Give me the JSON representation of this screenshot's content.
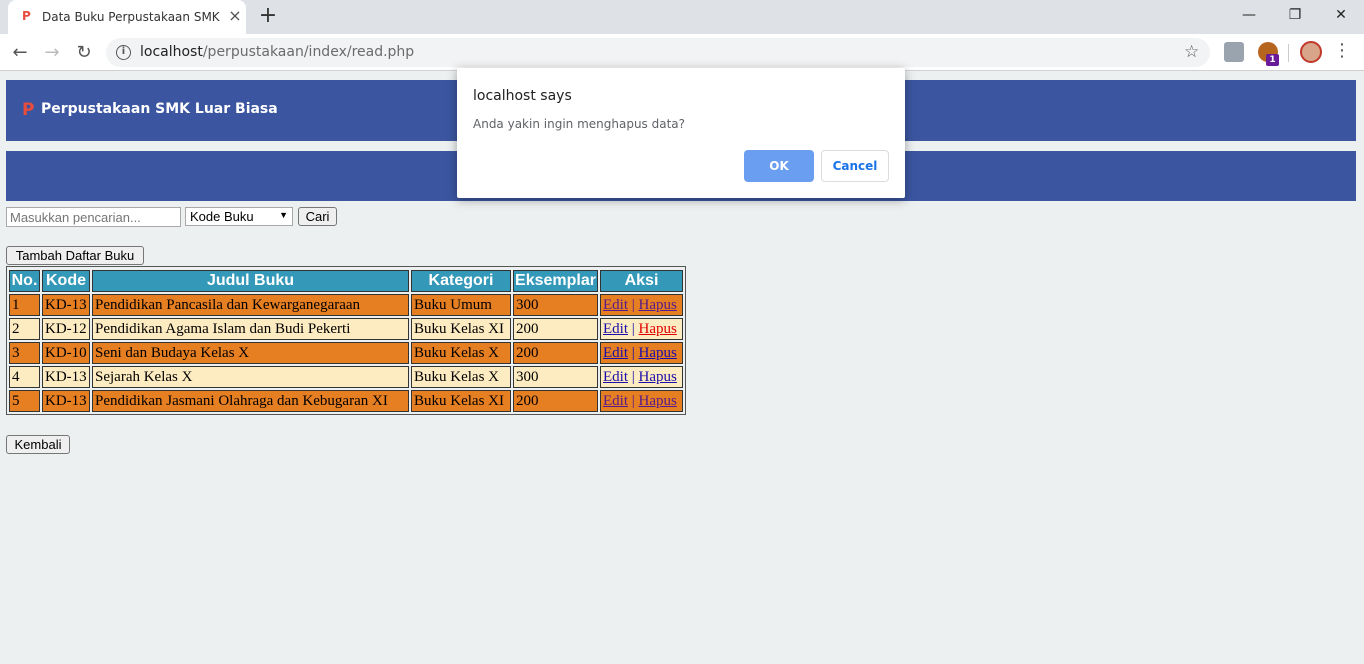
{
  "browser": {
    "tab_title": "Data Buku Perpustakaan SMK Lu",
    "tab_favicon": "P",
    "new_tab_label": "+",
    "url_host": "localhost",
    "url_path": "/perpustakaan/index/read.php",
    "extension_badge": "1"
  },
  "header": {
    "brand_icon": "P",
    "brand": "Perpustakaan SMK Luar Biasa"
  },
  "search": {
    "placeholder": "Masukkan pencarian...",
    "filter_selected": "Kode Buku",
    "search_button": "Cari"
  },
  "add_button": "Tambah Daftar Buku",
  "back_button": "Kembali",
  "table": {
    "headers": [
      "No.",
      "Kode",
      "Judul Buku",
      "Kategori",
      "Eksemplar",
      "Aksi"
    ],
    "rows": [
      {
        "no": "1",
        "kode": "KD-13",
        "judul": "Pendidikan Pancasila dan Kewarganegaraan",
        "kategori": "Buku Umum",
        "eksemplar": "300",
        "edit": "Edit",
        "sep": "|",
        "hapus": "Hapus"
      },
      {
        "no": "2",
        "kode": "KD-12",
        "judul": "Pendidikan Agama Islam dan Budi Pekerti",
        "kategori": "Buku Kelas XI",
        "eksemplar": "200",
        "edit": "Edit",
        "sep": "|",
        "hapus": "Hapus"
      },
      {
        "no": "3",
        "kode": "KD-10",
        "judul": "Seni dan Budaya Kelas X",
        "kategori": "Buku Kelas X",
        "eksemplar": "200",
        "edit": "Edit",
        "sep": "|",
        "hapus": "Hapus"
      },
      {
        "no": "4",
        "kode": "KD-13",
        "judul": "Sejarah Kelas X",
        "kategori": "Buku Kelas X",
        "eksemplar": "300",
        "edit": "Edit",
        "sep": "|",
        "hapus": "Hapus"
      },
      {
        "no": "5",
        "kode": "KD-13",
        "judul": "Pendidikan Jasmani Olahraga dan Kebugaran XI",
        "kategori": "Buku Kelas XI",
        "eksemplar": "200",
        "edit": "Edit",
        "sep": "|",
        "hapus": "Hapus"
      }
    ]
  },
  "dialog": {
    "title": "localhost says",
    "message": "Anda yakin ingin menghapus data?",
    "ok": "OK",
    "cancel": "Cancel"
  },
  "colors": {
    "header_bg": "#3b55a0",
    "table_header_bg": "#3498b8",
    "row_odd": "#e67e22",
    "row_even": "#fdebc1",
    "dialog_ok": "#6a9ef0"
  }
}
